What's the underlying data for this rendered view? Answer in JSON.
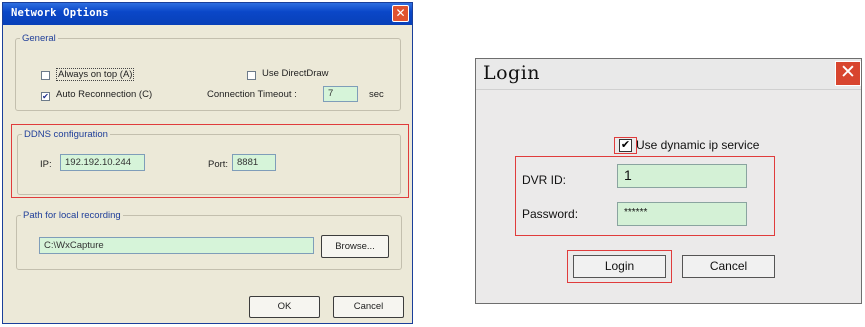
{
  "network_options": {
    "title": "Network Options",
    "close_glyph": "✕",
    "general": {
      "legend": "General",
      "always_on_top": {
        "label": "Always on top (A)",
        "checked": false
      },
      "use_directdraw": {
        "label": "Use DirectDraw",
        "checked": false
      },
      "auto_reconnection": {
        "label": "Auto Reconnection (C)",
        "checked": true
      },
      "connection_timeout": {
        "label": "Connection Timeout :",
        "value": "7",
        "unit": "sec"
      }
    },
    "ddns": {
      "legend": "DDNS configuration",
      "ip_label": "IP:",
      "ip_value": "192.192.10.244",
      "port_label": "Port:",
      "port_value": "8881"
    },
    "recording": {
      "legend": "Path for local recording",
      "path_value": "C:\\WxCapture",
      "browse_label": "Browse..."
    },
    "ok_label": "OK",
    "cancel_label": "Cancel",
    "check_glyph": "✔"
  },
  "login": {
    "title": "Login",
    "close_glyph": "✕",
    "dynamic_ip": {
      "label": "Use dynamic ip service",
      "checked": true
    },
    "dvr_id_label": "DVR ID:",
    "dvr_id_value": "1",
    "password_label": "Password:",
    "password_value": "******",
    "login_label": "Login",
    "cancel_label": "Cancel",
    "check_glyph": "✔"
  },
  "colors": {
    "highlight_box": "#e03c3c",
    "field_background": "#d6f4d9",
    "xp_titlebar": "#0a47c8"
  }
}
